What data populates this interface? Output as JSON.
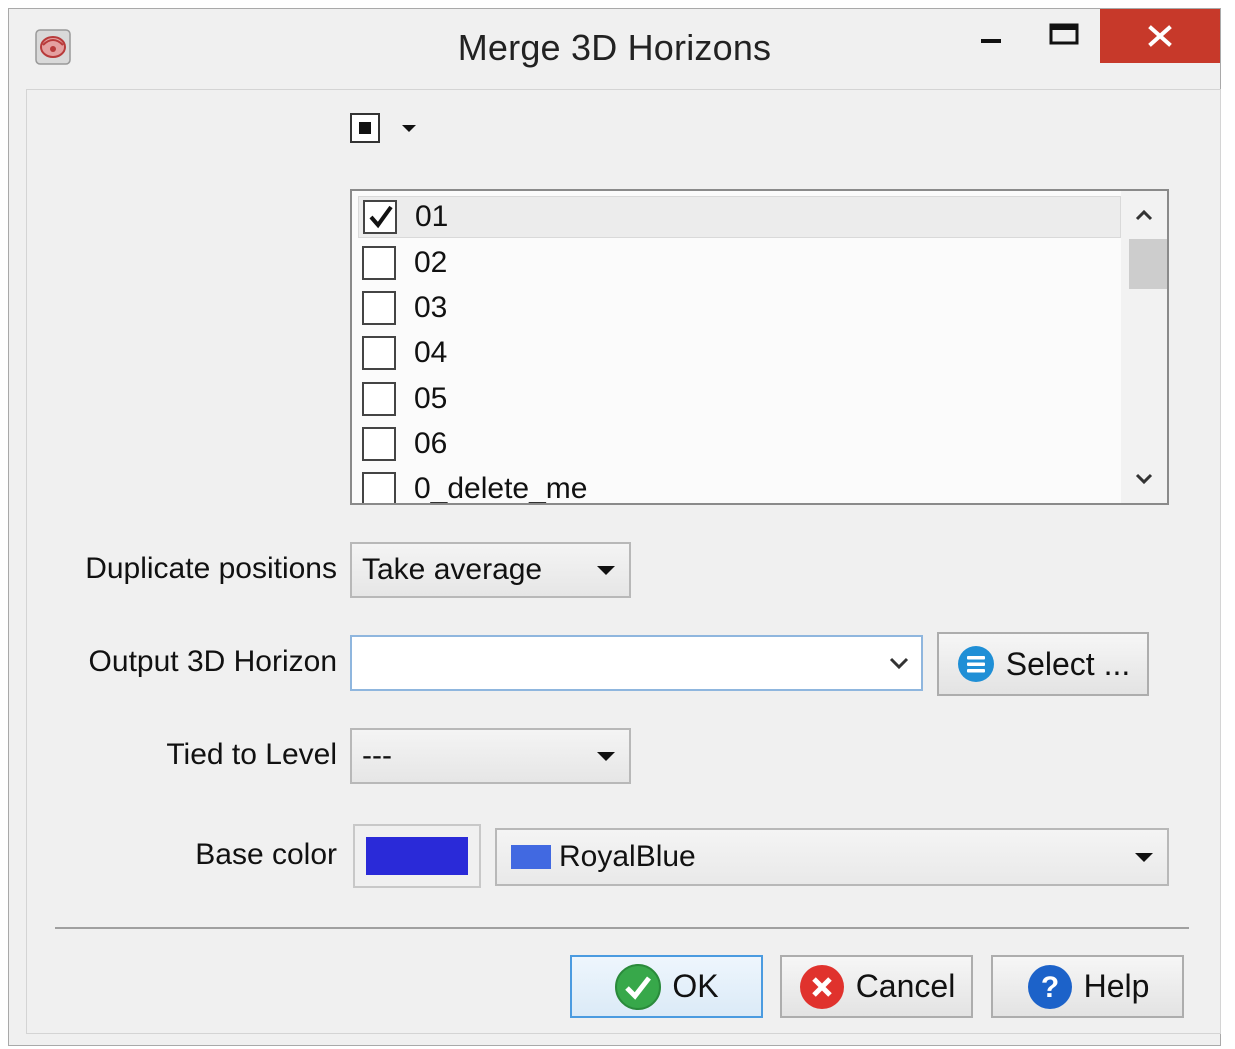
{
  "window": {
    "title": "Merge 3D Horizons",
    "close_color": "#c7392a"
  },
  "selector": {
    "select_all_state": "partial"
  },
  "horizon_list": {
    "items": [
      {
        "label": "01",
        "checked": true
      },
      {
        "label": "02",
        "checked": false
      },
      {
        "label": "03",
        "checked": false
      },
      {
        "label": "04",
        "checked": false
      },
      {
        "label": "05",
        "checked": false
      },
      {
        "label": "06",
        "checked": false
      },
      {
        "label": "0_delete_me",
        "checked": false
      }
    ]
  },
  "duplicate_positions": {
    "label": "Duplicate positions",
    "value": "Take average"
  },
  "output_horizon": {
    "label": "Output 3D Horizon",
    "value": "",
    "select_label": "Select ..."
  },
  "tied_to_level": {
    "label": "Tied to Level",
    "value": "---"
  },
  "base_color": {
    "label": "Base color",
    "swatch_color": "#2a2ad8",
    "color_name": "RoyalBlue",
    "chip_color": "#4169e1"
  },
  "buttons": {
    "ok": "OK",
    "cancel": "Cancel",
    "help": "Help"
  }
}
